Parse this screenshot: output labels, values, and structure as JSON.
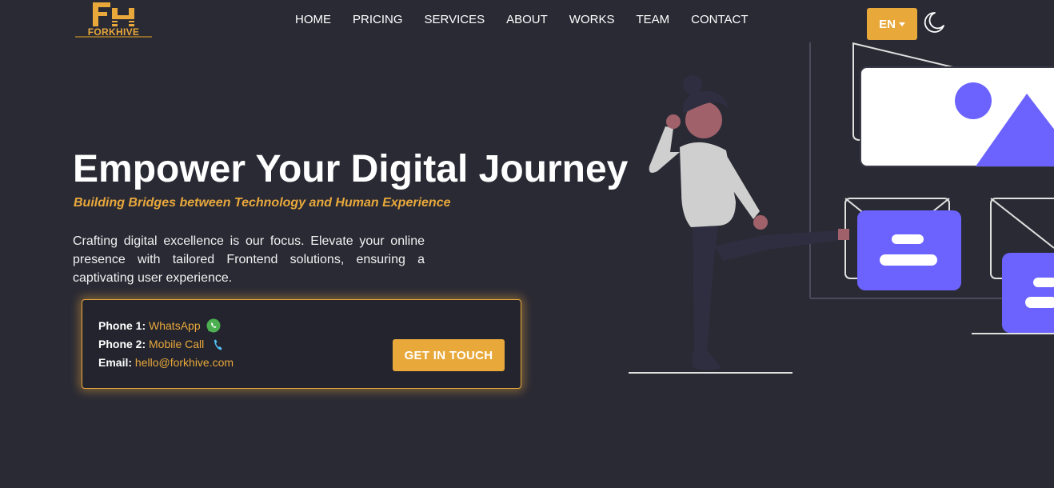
{
  "brand": {
    "name": "FORKHIVE"
  },
  "nav": {
    "items": [
      "HOME",
      "PRICING",
      "SERVICES",
      "ABOUT",
      "WORKS",
      "TEAM",
      "CONTACT"
    ]
  },
  "header": {
    "language": "EN",
    "theme_toggle_icon": "moon-icon"
  },
  "hero": {
    "title": "Empower Your Digital Journey",
    "subtitle": "Building Bridges between Technology and Human Experience",
    "description": "Crafting digital excellence is our focus. Elevate your online presence with tailored Frontend solutions, ensuring a captivating user experience."
  },
  "contact": {
    "phone1_label": "Phone 1:",
    "phone1_value": "WhatsApp",
    "phone2_label": "Phone 2:",
    "phone2_value": "Mobile Call",
    "email_label": "Email:",
    "email_value": "hello@forkhive.com",
    "cta_label": "GET IN TOUCH",
    "icons": [
      "whatsapp-icon",
      "phone-icon"
    ]
  },
  "colors": {
    "background": "#2a2a35",
    "accent": "#e8a83a",
    "illustration_purple": "#6c63ff",
    "whatsapp_green": "#4caf50"
  }
}
